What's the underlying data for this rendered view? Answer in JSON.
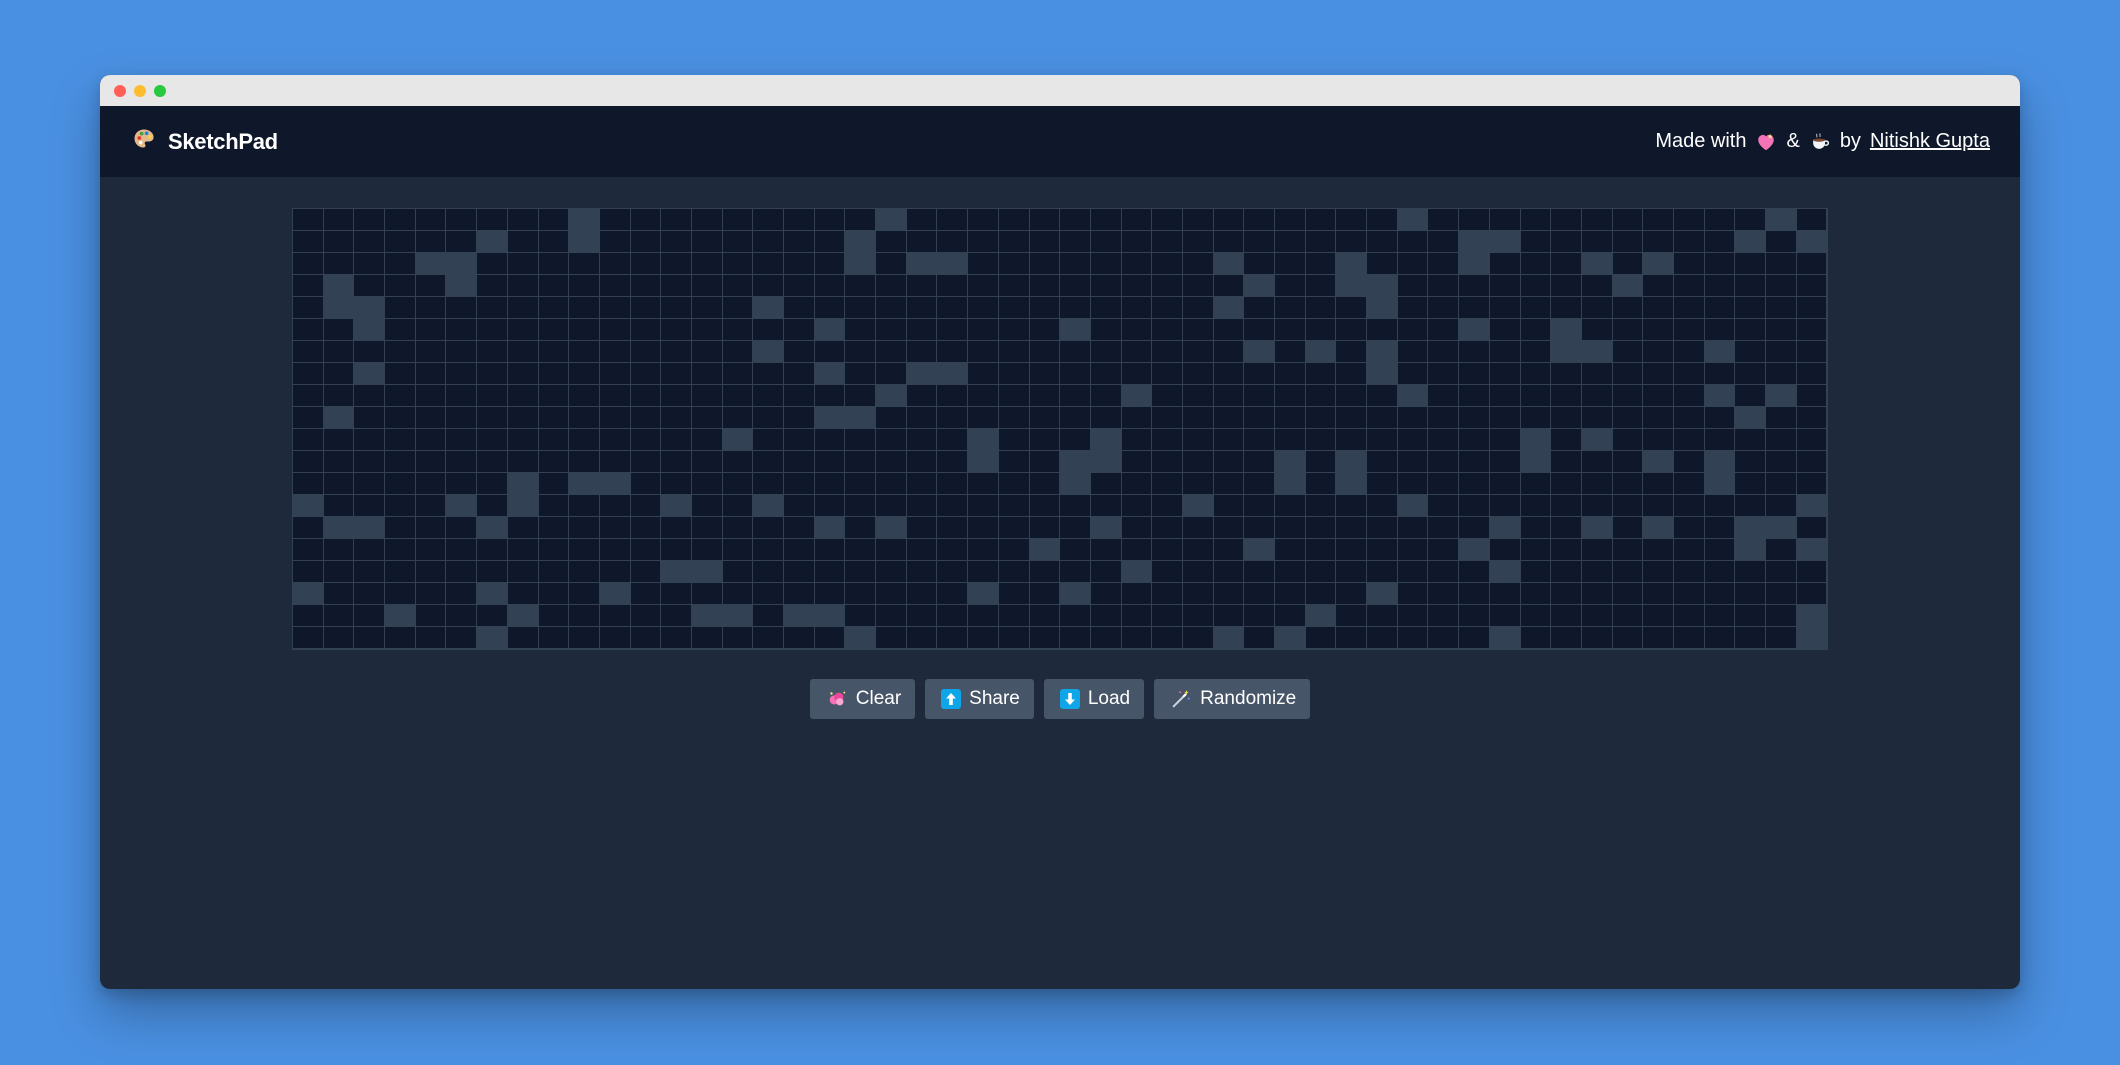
{
  "app": {
    "title": "SketchPad",
    "icon": "palette-icon"
  },
  "credit": {
    "made_with": "Made with",
    "amp": "&",
    "by": "by",
    "author": "Nitishk Gupta",
    "icons": [
      "heart-icon",
      "coffee-icon"
    ]
  },
  "grid": {
    "columns": 50,
    "rows": 20,
    "filled": [
      [
        0,
        9
      ],
      [
        0,
        19
      ],
      [
        0,
        36
      ],
      [
        0,
        48
      ],
      [
        1,
        6
      ],
      [
        1,
        9
      ],
      [
        1,
        18
      ],
      [
        1,
        38
      ],
      [
        1,
        39
      ],
      [
        1,
        47
      ],
      [
        1,
        49
      ],
      [
        2,
        4
      ],
      [
        2,
        5
      ],
      [
        2,
        18
      ],
      [
        2,
        20
      ],
      [
        2,
        21
      ],
      [
        2,
        30
      ],
      [
        2,
        34
      ],
      [
        2,
        38
      ],
      [
        2,
        42
      ],
      [
        2,
        44
      ],
      [
        3,
        1
      ],
      [
        3,
        5
      ],
      [
        3,
        31
      ],
      [
        3,
        34
      ],
      [
        3,
        35
      ],
      [
        3,
        43
      ],
      [
        4,
        1
      ],
      [
        4,
        2
      ],
      [
        4,
        15
      ],
      [
        4,
        30
      ],
      [
        4,
        35
      ],
      [
        5,
        2
      ],
      [
        5,
        17
      ],
      [
        5,
        25
      ],
      [
        5,
        38
      ],
      [
        5,
        41
      ],
      [
        6,
        15
      ],
      [
        6,
        31
      ],
      [
        6,
        33
      ],
      [
        6,
        35
      ],
      [
        6,
        41
      ],
      [
        6,
        42
      ],
      [
        6,
        46
      ],
      [
        7,
        2
      ],
      [
        7,
        17
      ],
      [
        7,
        20
      ],
      [
        7,
        21
      ],
      [
        7,
        35
      ],
      [
        8,
        19
      ],
      [
        8,
        27
      ],
      [
        8,
        36
      ],
      [
        8,
        46
      ],
      [
        8,
        48
      ],
      [
        9,
        1
      ],
      [
        9,
        17
      ],
      [
        9,
        18
      ],
      [
        9,
        47
      ],
      [
        10,
        14
      ],
      [
        10,
        22
      ],
      [
        10,
        26
      ],
      [
        10,
        40
      ],
      [
        10,
        42
      ],
      [
        11,
        22
      ],
      [
        11,
        25
      ],
      [
        11,
        26
      ],
      [
        11,
        32
      ],
      [
        11,
        34
      ],
      [
        11,
        40
      ],
      [
        11,
        44
      ],
      [
        11,
        46
      ],
      [
        12,
        7
      ],
      [
        12,
        9
      ],
      [
        12,
        10
      ],
      [
        12,
        25
      ],
      [
        12,
        32
      ],
      [
        12,
        34
      ],
      [
        12,
        46
      ],
      [
        13,
        0
      ],
      [
        13,
        5
      ],
      [
        13,
        7
      ],
      [
        13,
        12
      ],
      [
        13,
        15
      ],
      [
        13,
        29
      ],
      [
        13,
        36
      ],
      [
        13,
        49
      ],
      [
        14,
        1
      ],
      [
        14,
        2
      ],
      [
        14,
        6
      ],
      [
        14,
        17
      ],
      [
        14,
        19
      ],
      [
        14,
        26
      ],
      [
        14,
        39
      ],
      [
        14,
        42
      ],
      [
        14,
        44
      ],
      [
        14,
        47
      ],
      [
        14,
        48
      ],
      [
        15,
        24
      ],
      [
        15,
        31
      ],
      [
        15,
        38
      ],
      [
        15,
        47
      ],
      [
        15,
        49
      ],
      [
        16,
        12
      ],
      [
        16,
        13
      ],
      [
        16,
        27
      ],
      [
        16,
        39
      ],
      [
        17,
        0
      ],
      [
        17,
        6
      ],
      [
        17,
        10
      ],
      [
        17,
        22
      ],
      [
        17,
        25
      ],
      [
        17,
        35
      ],
      [
        18,
        3
      ],
      [
        18,
        7
      ],
      [
        18,
        13
      ],
      [
        18,
        14
      ],
      [
        18,
        16
      ],
      [
        18,
        17
      ],
      [
        18,
        33
      ],
      [
        18,
        49
      ],
      [
        19,
        6
      ],
      [
        19,
        18
      ],
      [
        19,
        30
      ],
      [
        19,
        32
      ],
      [
        19,
        39
      ],
      [
        19,
        49
      ]
    ]
  },
  "buttons": [
    {
      "label": "Clear",
      "icon": "sparkle-cloud-icon"
    },
    {
      "label": "Share",
      "icon": "up-arrow-icon"
    },
    {
      "label": "Load",
      "icon": "down-arrow-icon"
    },
    {
      "label": "Randomize",
      "icon": "magic-wand-icon"
    }
  ],
  "colors": {
    "page_background": "#4a90e2",
    "app_background": "#1e293b",
    "navbar_background": "#0f172a",
    "cell_empty": "#0f172a",
    "cell_filled": "#334155",
    "button_background": "#475569",
    "text": "#ffffff"
  }
}
